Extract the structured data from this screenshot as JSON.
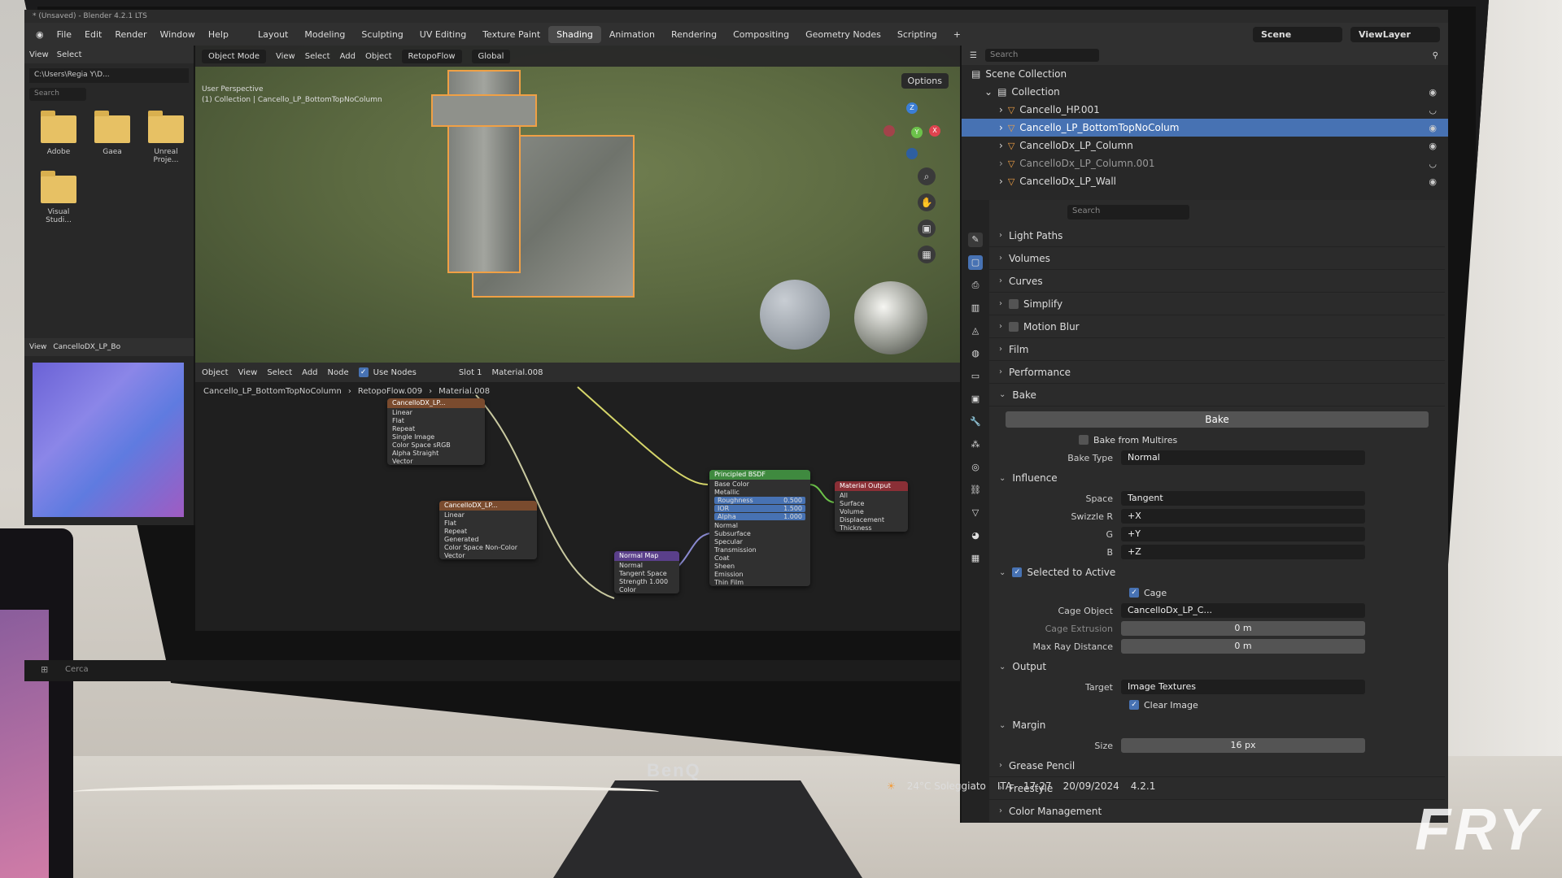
{
  "window": {
    "title": "* (Unsaved) - Blender 4.2.1 LTS"
  },
  "menu": {
    "items": [
      "File",
      "Edit",
      "Render",
      "Window",
      "Help"
    ],
    "workspaces": [
      "Layout",
      "Modeling",
      "Sculpting",
      "UV Editing",
      "Texture Paint",
      "Shading",
      "Animation",
      "Rendering",
      "Compositing",
      "Geometry Nodes",
      "Scripting",
      "+"
    ],
    "active_workspace": "Shading",
    "scene": "Scene",
    "view_layer": "ViewLayer"
  },
  "file_browser": {
    "header": [
      "View",
      "Select"
    ],
    "path": "C:\\Users\\Regia Y\\D...",
    "search_placeholder": "Search",
    "folders": [
      "Adobe",
      "Gaea",
      "Unreal Proje...",
      "Visual Studi..."
    ]
  },
  "viewport": {
    "mode": "Object Mode",
    "menu": [
      "View",
      "Select",
      "Add",
      "Object"
    ],
    "object_name": "RetopoFlow",
    "orientation": "Global",
    "info_line1": "User Perspective",
    "info_line2": "(1) Collection | Cancello_LP_BottomTopNoColumn",
    "options_label": "Options",
    "gizmo_axes": {
      "x": "X",
      "y": "Y",
      "z": "Z"
    }
  },
  "image_editor": {
    "title": "CancelloDX_LP_Bo",
    "view": "View"
  },
  "node_editor": {
    "mode": "Object",
    "menu": [
      "View",
      "Select",
      "Add",
      "Node"
    ],
    "use_nodes": "Use Nodes",
    "slot": "Slot 1",
    "material": "Material.008",
    "breadcrumb": [
      "Cancello_LP_BottomTopNoColumn",
      "RetopoFlow.009",
      "Material.008"
    ],
    "nodes": {
      "image1": {
        "title": "CancelloDX_LP...",
        "rows": [
          "Linear",
          "Flat",
          "Repeat",
          "Single Image",
          "Color Space  sRGB",
          "Alpha  Straight",
          "Vector"
        ]
      },
      "image2": {
        "title": "CancelloDX_LP...",
        "rows": [
          "Linear",
          "Flat",
          "Repeat",
          "Generated",
          "Color Space  Non-Color",
          "Vector"
        ]
      },
      "bsdf": {
        "title": "Principled BSDF",
        "rows": [
          "Base Color",
          "Metallic",
          "Normal",
          "Subsurface",
          "Specular",
          "Transmission",
          "Coat",
          "Sheen",
          "Emission",
          "Thin Film"
        ],
        "bars": [
          {
            "label": "Roughness",
            "value": "0.500"
          },
          {
            "label": "IOR",
            "value": "1.500"
          },
          {
            "label": "Alpha",
            "value": "1.000"
          }
        ]
      },
      "output": {
        "title": "Material Output",
        "rows": [
          "All",
          "Surface",
          "Volume",
          "Displacement",
          "Thickness"
        ]
      },
      "normal_map": {
        "title": "Normal Map",
        "rows": [
          "Normal",
          "Tangent Space",
          "Strength  1.000",
          "Color"
        ]
      }
    }
  },
  "outliner": {
    "search_placeholder": "Search",
    "root": "Scene Collection",
    "collection": "Collection",
    "items": [
      {
        "name": "Cancello_HP.001",
        "selected": false
      },
      {
        "name": "Cancello_LP_BottomTopNoColum",
        "selected": true
      },
      {
        "name": "CancelloDx_LP_Column",
        "selected": false
      },
      {
        "name": "CancelloDx_LP_Column.001",
        "selected": false
      },
      {
        "name": "CancelloDx_LP_Wall",
        "selected": false
      }
    ]
  },
  "properties": {
    "search_placeholder": "Search",
    "panels_top": [
      "Light Paths",
      "Volumes",
      "Curves",
      "Simplify",
      "Motion Blur",
      "Film",
      "Performance",
      "Bake"
    ],
    "bake_button": "Bake",
    "bake_from_multires": "Bake from Multires",
    "bake_type_label": "Bake Type",
    "bake_type": "Normal",
    "influence": "Influence",
    "space_label": "Space",
    "space": "Tangent",
    "swizzle_r_label": "Swizzle R",
    "swizzle_r": "+X",
    "swizzle_g_label": "G",
    "swizzle_g": "+Y",
    "swizzle_b_label": "B",
    "swizzle_b": "+Z",
    "selected_to_active": "Selected to Active",
    "cage": "Cage",
    "cage_object_label": "Cage Object",
    "cage_object": "CancelloDx_LP_C...",
    "cage_extrusion_label": "Cage Extrusion",
    "cage_extrusion": "0 m",
    "max_ray_label": "Max Ray Distance",
    "max_ray": "0 m",
    "output": "Output",
    "target_label": "Target",
    "target": "Image Textures",
    "clear_image": "Clear Image",
    "margin": "Margin",
    "size_label": "Size",
    "size": "16 px",
    "panels_bottom": [
      "Grease Pencil",
      "Freestyle",
      "Color Management"
    ]
  },
  "system": {
    "weather": "24°C Soleggiato",
    "lang": "ITA",
    "time": "17:27",
    "date": "20/09/2024",
    "version": "4.2.1"
  },
  "taskbar": {
    "search": "Cerca"
  },
  "hardware": {
    "brand": "BenQ"
  },
  "watermark": "FRY"
}
